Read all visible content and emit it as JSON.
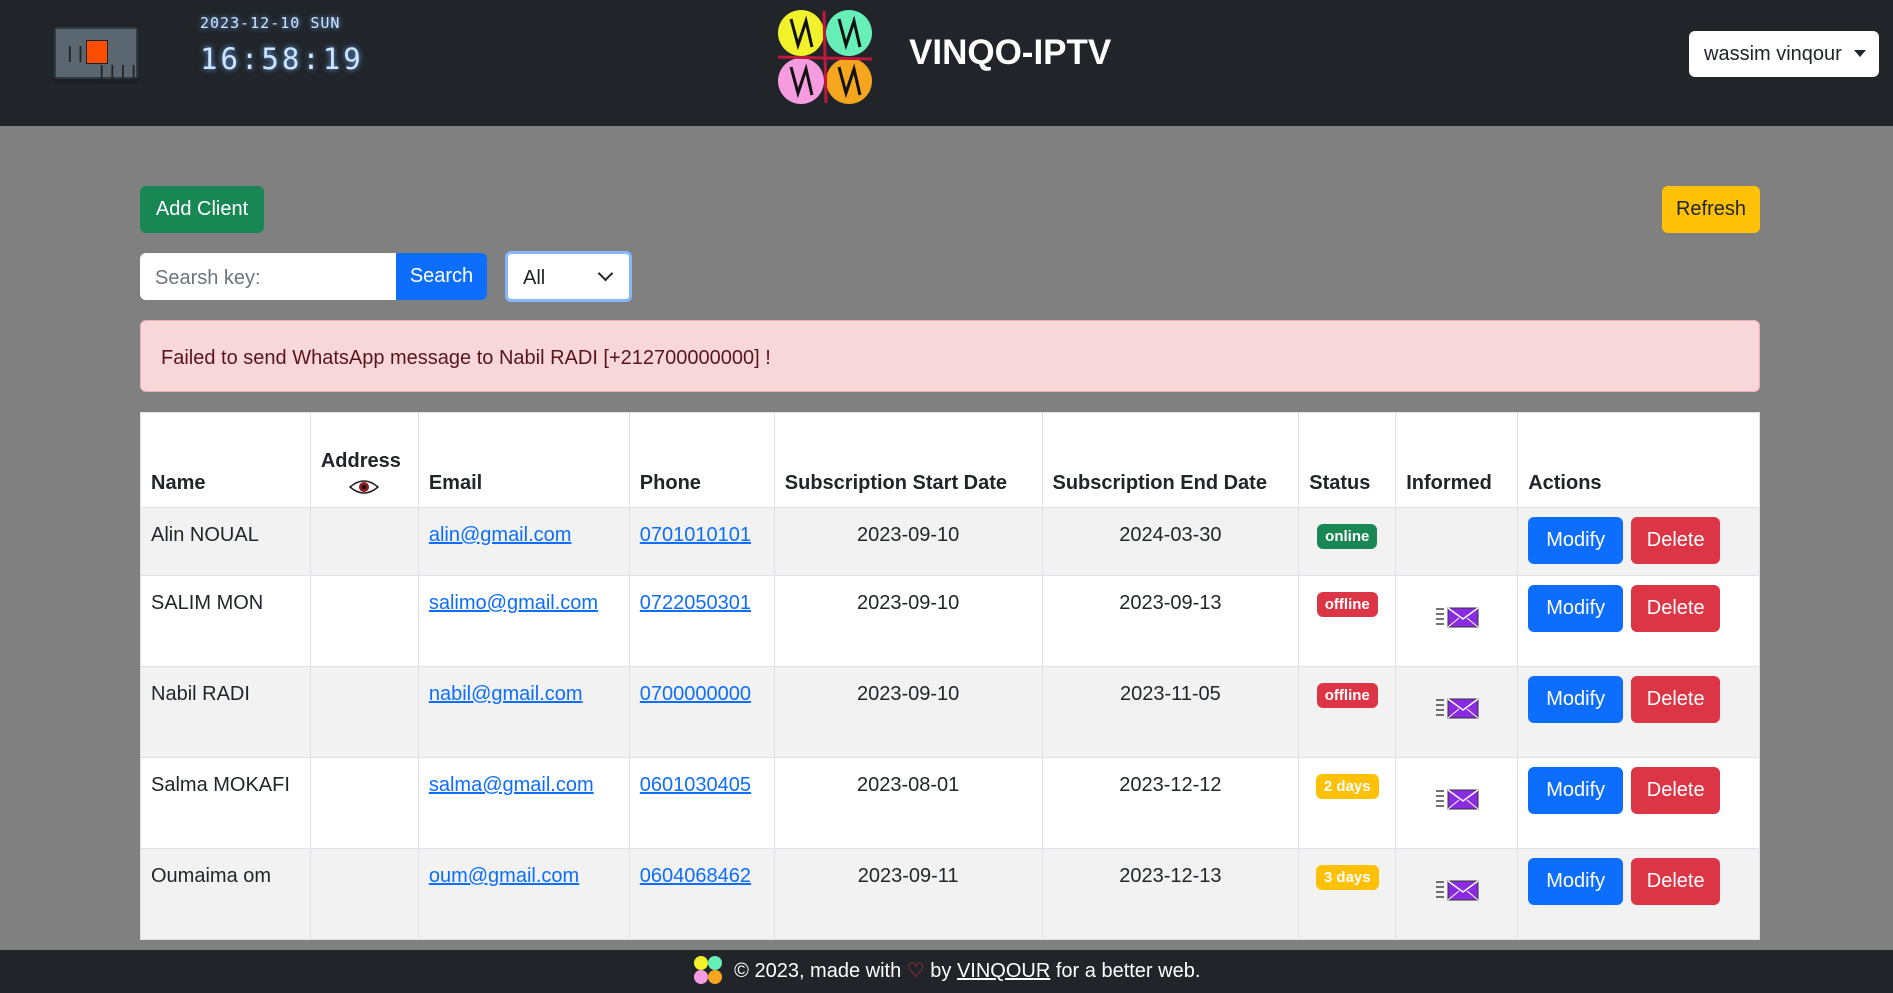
{
  "header": {
    "date": "2023-12-10 SUN",
    "time": "16:58:19",
    "brand": "VINQO-IPTV",
    "user": "wassim vinqour"
  },
  "toolbar": {
    "add_label": "Add Client",
    "refresh_label": "Refresh",
    "search_placeholder": "Searsh key:",
    "search_label": "Search",
    "filter_value": "All"
  },
  "alert": {
    "message": "Failed to send WhatsApp message to Nabil RADI [+212700000000] !"
  },
  "table": {
    "columns": [
      "Name",
      "Address",
      "Email",
      "Phone",
      "Subscription Start Date",
      "Subscription End Date",
      "Status",
      "Informed",
      "Actions"
    ],
    "modify_label": "Modify",
    "delete_label": "Delete",
    "rows": [
      {
        "name": "Alin NOUAL",
        "email": "alin@gmail.com",
        "phone": "0701010101",
        "start": "2023-09-10",
        "end": "2024-03-30",
        "status": "online",
        "informed": false
      },
      {
        "name": "SALIM MON",
        "email": "salimo@gmail.com",
        "phone": "0722050301",
        "start": "2023-09-10",
        "end": "2023-09-13",
        "status": "offline",
        "informed": true
      },
      {
        "name": "Nabil RADI",
        "email": "nabil@gmail.com",
        "phone": "0700000000",
        "start": "2023-09-10",
        "end": "2023-11-05",
        "status": "offline",
        "informed": true
      },
      {
        "name": "Salma MOKAFI",
        "email": "salma@gmail.com",
        "phone": "0601030405",
        "start": "2023-08-01",
        "end": "2023-12-12",
        "status": "2 days",
        "informed": true
      },
      {
        "name": "Oumaima om",
        "email": "oum@gmail.com",
        "phone": "0604068462",
        "start": "2023-09-11",
        "end": "2023-12-13",
        "status": "3 days",
        "informed": true
      }
    ]
  },
  "footer": {
    "prefix": "© 2023, made with",
    "heart": "♡",
    "by": "by",
    "author": "VINQOUR",
    "suffix": "for a better web."
  },
  "colors": {
    "navbar": "#212529",
    "page_bg": "#808080",
    "primary": "#0d6efd",
    "success": "#198754",
    "danger": "#dc3545",
    "warning": "#ffc107",
    "alert_bg": "#f8d7da"
  }
}
